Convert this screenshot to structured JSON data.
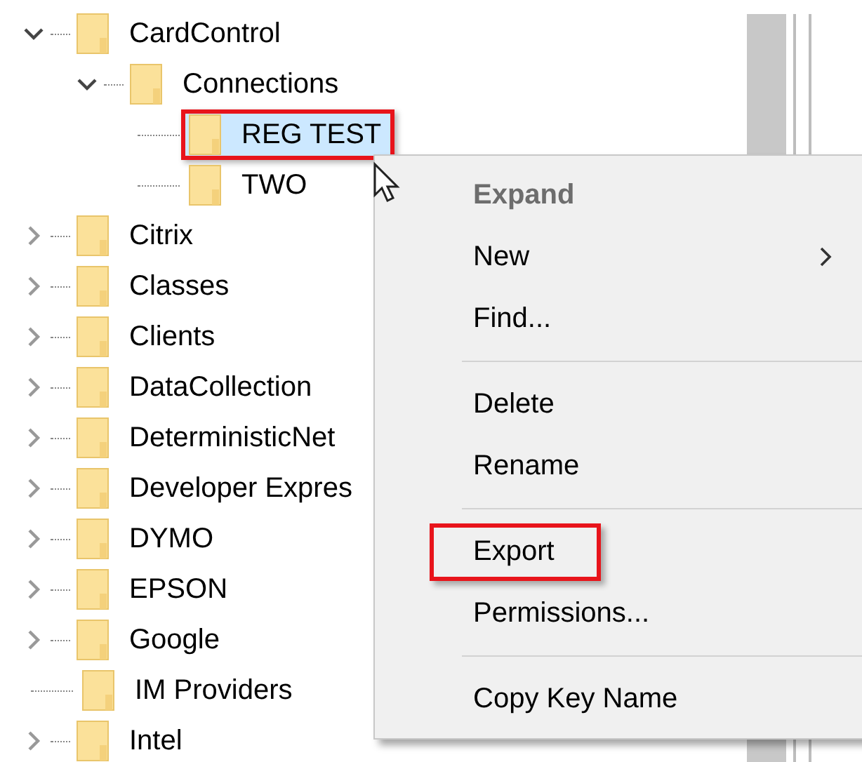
{
  "tree": [
    {
      "label": "CardControl",
      "kind": "branch",
      "expanded": true,
      "selected": false,
      "annotated": false,
      "children": [
        {
          "label": "Connections",
          "kind": "branch",
          "expanded": true,
          "selected": false,
          "annotated": false,
          "children": [
            {
              "label": "REG TEST",
              "kind": "leaf",
              "selected": true,
              "annotated": true
            },
            {
              "label": "TWO",
              "kind": "leaf",
              "selected": false,
              "annotated": false
            }
          ]
        }
      ]
    },
    {
      "label": "Citrix",
      "kind": "branch",
      "expanded": false,
      "selected": false,
      "annotated": false
    },
    {
      "label": "Classes",
      "kind": "branch",
      "expanded": false,
      "selected": false,
      "annotated": false
    },
    {
      "label": "Clients",
      "kind": "branch",
      "expanded": false,
      "selected": false,
      "annotated": false
    },
    {
      "label": "DataCollection",
      "kind": "branch",
      "expanded": false,
      "selected": false,
      "annotated": false
    },
    {
      "label": "DeterministicNet",
      "kind": "branch",
      "expanded": false,
      "selected": false,
      "annotated": false
    },
    {
      "label": "Developer Expres",
      "kind": "branch",
      "expanded": false,
      "selected": false,
      "annotated": false
    },
    {
      "label": "DYMO",
      "kind": "branch",
      "expanded": false,
      "selected": false,
      "annotated": false
    },
    {
      "label": "EPSON",
      "kind": "branch",
      "expanded": false,
      "selected": false,
      "annotated": false
    },
    {
      "label": "Google",
      "kind": "branch",
      "expanded": false,
      "selected": false,
      "annotated": false
    },
    {
      "label": "IM Providers",
      "kind": "leaf",
      "selected": false,
      "annotated": false
    },
    {
      "label": "Intel",
      "kind": "branch",
      "expanded": false,
      "selected": false,
      "annotated": false
    }
  ],
  "context_menu": [
    {
      "kind": "item",
      "label": "Expand",
      "disabled": true,
      "submenu": false,
      "annotated": false
    },
    {
      "kind": "item",
      "label": "New",
      "disabled": false,
      "submenu": true,
      "annotated": false
    },
    {
      "kind": "item",
      "label": "Find...",
      "disabled": false,
      "submenu": false,
      "annotated": false
    },
    {
      "kind": "separator"
    },
    {
      "kind": "item",
      "label": "Delete",
      "disabled": false,
      "submenu": false,
      "annotated": false
    },
    {
      "kind": "item",
      "label": "Rename",
      "disabled": false,
      "submenu": false,
      "annotated": false
    },
    {
      "kind": "separator"
    },
    {
      "kind": "item",
      "label": "Export",
      "disabled": false,
      "submenu": false,
      "annotated": true
    },
    {
      "kind": "item",
      "label": "Permissions...",
      "disabled": false,
      "submenu": false,
      "annotated": false
    },
    {
      "kind": "separator"
    },
    {
      "kind": "item",
      "label": "Copy Key Name",
      "disabled": false,
      "submenu": false,
      "annotated": false
    }
  ]
}
